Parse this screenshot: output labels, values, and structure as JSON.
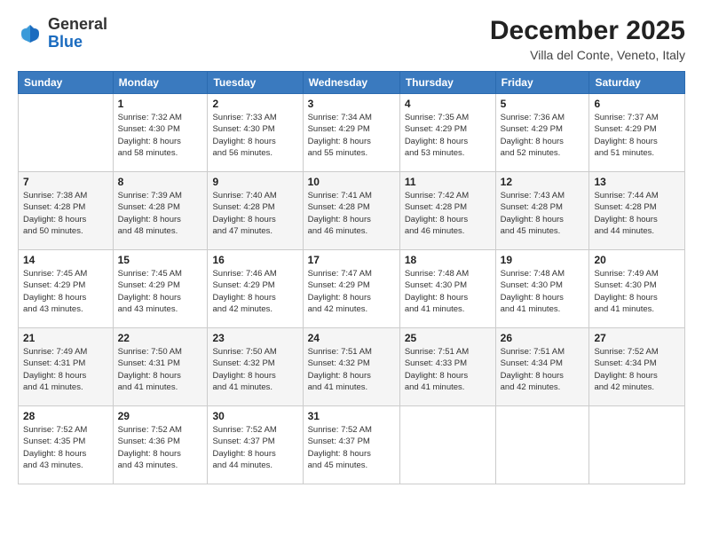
{
  "header": {
    "logo_general": "General",
    "logo_blue": "Blue",
    "month_title": "December 2025",
    "subtitle": "Villa del Conte, Veneto, Italy"
  },
  "calendar": {
    "days_of_week": [
      "Sunday",
      "Monday",
      "Tuesday",
      "Wednesday",
      "Thursday",
      "Friday",
      "Saturday"
    ],
    "weeks": [
      [
        {
          "day": "",
          "info": ""
        },
        {
          "day": "1",
          "info": "Sunrise: 7:32 AM\nSunset: 4:30 PM\nDaylight: 8 hours\nand 58 minutes."
        },
        {
          "day": "2",
          "info": "Sunrise: 7:33 AM\nSunset: 4:30 PM\nDaylight: 8 hours\nand 56 minutes."
        },
        {
          "day": "3",
          "info": "Sunrise: 7:34 AM\nSunset: 4:29 PM\nDaylight: 8 hours\nand 55 minutes."
        },
        {
          "day": "4",
          "info": "Sunrise: 7:35 AM\nSunset: 4:29 PM\nDaylight: 8 hours\nand 53 minutes."
        },
        {
          "day": "5",
          "info": "Sunrise: 7:36 AM\nSunset: 4:29 PM\nDaylight: 8 hours\nand 52 minutes."
        },
        {
          "day": "6",
          "info": "Sunrise: 7:37 AM\nSunset: 4:29 PM\nDaylight: 8 hours\nand 51 minutes."
        }
      ],
      [
        {
          "day": "7",
          "info": "Sunrise: 7:38 AM\nSunset: 4:28 PM\nDaylight: 8 hours\nand 50 minutes."
        },
        {
          "day": "8",
          "info": "Sunrise: 7:39 AM\nSunset: 4:28 PM\nDaylight: 8 hours\nand 48 minutes."
        },
        {
          "day": "9",
          "info": "Sunrise: 7:40 AM\nSunset: 4:28 PM\nDaylight: 8 hours\nand 47 minutes."
        },
        {
          "day": "10",
          "info": "Sunrise: 7:41 AM\nSunset: 4:28 PM\nDaylight: 8 hours\nand 46 minutes."
        },
        {
          "day": "11",
          "info": "Sunrise: 7:42 AM\nSunset: 4:28 PM\nDaylight: 8 hours\nand 46 minutes."
        },
        {
          "day": "12",
          "info": "Sunrise: 7:43 AM\nSunset: 4:28 PM\nDaylight: 8 hours\nand 45 minutes."
        },
        {
          "day": "13",
          "info": "Sunrise: 7:44 AM\nSunset: 4:28 PM\nDaylight: 8 hours\nand 44 minutes."
        }
      ],
      [
        {
          "day": "14",
          "info": "Sunrise: 7:45 AM\nSunset: 4:29 PM\nDaylight: 8 hours\nand 43 minutes."
        },
        {
          "day": "15",
          "info": "Sunrise: 7:45 AM\nSunset: 4:29 PM\nDaylight: 8 hours\nand 43 minutes."
        },
        {
          "day": "16",
          "info": "Sunrise: 7:46 AM\nSunset: 4:29 PM\nDaylight: 8 hours\nand 42 minutes."
        },
        {
          "day": "17",
          "info": "Sunrise: 7:47 AM\nSunset: 4:29 PM\nDaylight: 8 hours\nand 42 minutes."
        },
        {
          "day": "18",
          "info": "Sunrise: 7:48 AM\nSunset: 4:30 PM\nDaylight: 8 hours\nand 41 minutes."
        },
        {
          "day": "19",
          "info": "Sunrise: 7:48 AM\nSunset: 4:30 PM\nDaylight: 8 hours\nand 41 minutes."
        },
        {
          "day": "20",
          "info": "Sunrise: 7:49 AM\nSunset: 4:30 PM\nDaylight: 8 hours\nand 41 minutes."
        }
      ],
      [
        {
          "day": "21",
          "info": "Sunrise: 7:49 AM\nSunset: 4:31 PM\nDaylight: 8 hours\nand 41 minutes."
        },
        {
          "day": "22",
          "info": "Sunrise: 7:50 AM\nSunset: 4:31 PM\nDaylight: 8 hours\nand 41 minutes."
        },
        {
          "day": "23",
          "info": "Sunrise: 7:50 AM\nSunset: 4:32 PM\nDaylight: 8 hours\nand 41 minutes."
        },
        {
          "day": "24",
          "info": "Sunrise: 7:51 AM\nSunset: 4:32 PM\nDaylight: 8 hours\nand 41 minutes."
        },
        {
          "day": "25",
          "info": "Sunrise: 7:51 AM\nSunset: 4:33 PM\nDaylight: 8 hours\nand 41 minutes."
        },
        {
          "day": "26",
          "info": "Sunrise: 7:51 AM\nSunset: 4:34 PM\nDaylight: 8 hours\nand 42 minutes."
        },
        {
          "day": "27",
          "info": "Sunrise: 7:52 AM\nSunset: 4:34 PM\nDaylight: 8 hours\nand 42 minutes."
        }
      ],
      [
        {
          "day": "28",
          "info": "Sunrise: 7:52 AM\nSunset: 4:35 PM\nDaylight: 8 hours\nand 43 minutes."
        },
        {
          "day": "29",
          "info": "Sunrise: 7:52 AM\nSunset: 4:36 PM\nDaylight: 8 hours\nand 43 minutes."
        },
        {
          "day": "30",
          "info": "Sunrise: 7:52 AM\nSunset: 4:37 PM\nDaylight: 8 hours\nand 44 minutes."
        },
        {
          "day": "31",
          "info": "Sunrise: 7:52 AM\nSunset: 4:37 PM\nDaylight: 8 hours\nand 45 minutes."
        },
        {
          "day": "",
          "info": ""
        },
        {
          "day": "",
          "info": ""
        },
        {
          "day": "",
          "info": ""
        }
      ]
    ]
  }
}
